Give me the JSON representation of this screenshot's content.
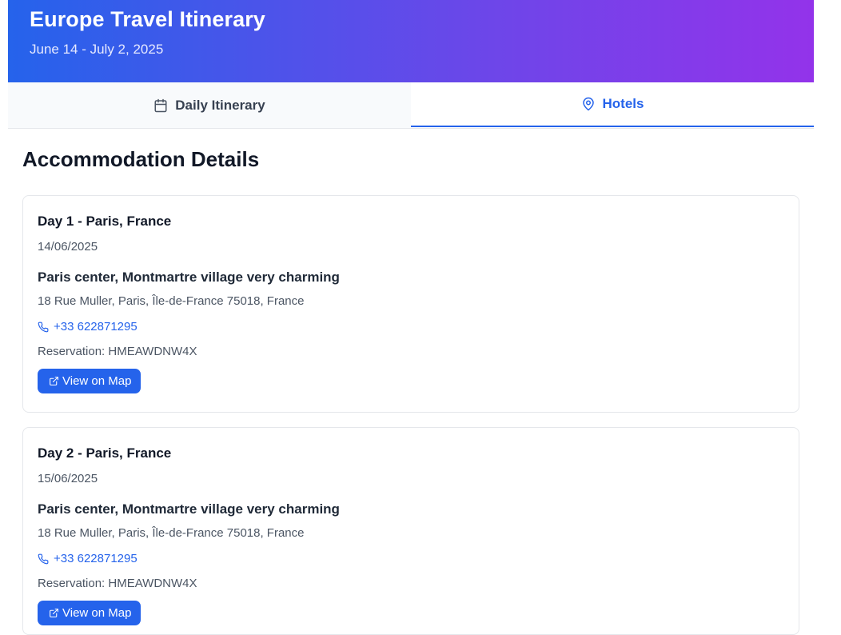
{
  "header": {
    "title": "Europe Travel Itinerary",
    "dates": "June 14 - July 2, 2025"
  },
  "tabs": [
    {
      "label": "Daily Itinerary",
      "icon": "calendar-icon",
      "active": false
    },
    {
      "label": "Hotels",
      "icon": "map-pin-icon",
      "active": true
    }
  ],
  "section": {
    "title": "Accommodation Details"
  },
  "hotels": [
    {
      "day": "Day 1 - Paris, France",
      "date": "14/06/2025",
      "name": "Paris center, Montmartre village very charming",
      "address": "18 Rue Muller, Paris, Île-de-France 75018, France",
      "phone": "+33 622871295",
      "reservation_label": "Reservation:",
      "reservation_code": "HMEAWDNW4X",
      "button_label": "View on Map"
    },
    {
      "day": "Day 2 - Paris, France",
      "date": "15/06/2025",
      "name": "Paris center, Montmartre village very charming",
      "address": "18 Rue Muller, Paris, Île-de-France 75018, France",
      "phone": "+33 622871295",
      "reservation_label": "Reservation:",
      "reservation_code": "HMEAWDNW4X",
      "button_label": "View on Map"
    }
  ],
  "colors": {
    "accent": "#2563eb",
    "header_gradient_start": "#2563eb",
    "header_gradient_end": "#9333ea"
  }
}
